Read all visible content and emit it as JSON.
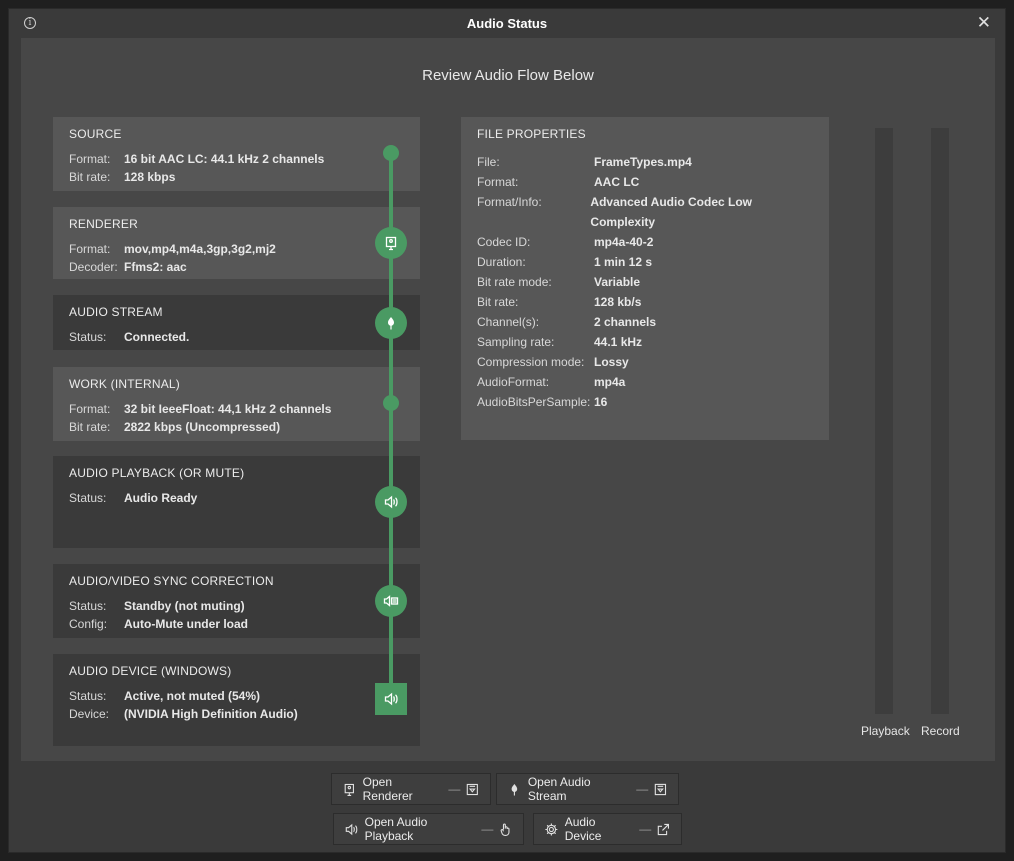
{
  "window": {
    "title": "Audio Status"
  },
  "heading": "Review Audio Flow Below",
  "source": {
    "title": "SOURCE",
    "rows": [
      {
        "label": "Format:",
        "value": "16 bit AAC LC: 44.1 kHz 2 channels"
      },
      {
        "label": "Bit rate:",
        "value": "128 kbps"
      }
    ]
  },
  "renderer": {
    "title": "RENDERER",
    "rows": [
      {
        "label": "Format:",
        "value": "mov,mp4,m4a,3gp,3g2,mj2"
      },
      {
        "label": "Decoder:",
        "value": "Ffms2: aac"
      }
    ]
  },
  "audio_stream": {
    "title": "AUDIO STREAM",
    "rows": [
      {
        "label": "Status:",
        "value": "Connected."
      }
    ]
  },
  "work": {
    "title": "WORK (INTERNAL)",
    "rows": [
      {
        "label": "Format:",
        "value": "32 bit IeeeFloat: 44,1 kHz 2 channels"
      },
      {
        "label": "Bit rate:",
        "value": "2822 kbps (Uncompressed)"
      }
    ]
  },
  "playback": {
    "title": "AUDIO PLAYBACK (OR MUTE)",
    "rows": [
      {
        "label": "Status:",
        "value": "Audio Ready"
      }
    ]
  },
  "sync": {
    "title": "AUDIO/VIDEO SYNC CORRECTION",
    "rows": [
      {
        "label": "Status:",
        "value": "Standby (not muting)"
      },
      {
        "label": "Config:",
        "value": "Auto-Mute under load"
      }
    ]
  },
  "device": {
    "title": "AUDIO DEVICE (WINDOWS)",
    "rows": [
      {
        "label": "Status:",
        "value": "Active, not muted (54%)"
      },
      {
        "label": "Device:",
        "value": "(NVIDIA High Definition Audio)"
      }
    ]
  },
  "file_properties": {
    "title": "FILE PROPERTIES",
    "rows": [
      {
        "label": "File:",
        "value": "FrameTypes.mp4"
      },
      {
        "label": "Format:",
        "value": "AAC LC"
      },
      {
        "label": "Format/Info:",
        "value": "Advanced Audio Codec Low Complexity"
      },
      {
        "label": "Codec ID:",
        "value": "mp4a-40-2"
      },
      {
        "label": "Duration:",
        "value": "1 min 12 s"
      },
      {
        "label": "Bit rate mode:",
        "value": "Variable"
      },
      {
        "label": "Bit rate:",
        "value": "128 kb/s"
      },
      {
        "label": "Channel(s):",
        "value": "2 channels"
      },
      {
        "label": "Sampling rate:",
        "value": "44.1 kHz"
      },
      {
        "label": "Compression mode:",
        "value": "Lossy"
      },
      {
        "label": "AudioFormat:",
        "value": "mp4a"
      },
      {
        "label": "AudioBitsPerSample:",
        "value": "16"
      }
    ]
  },
  "meters": {
    "playback_label": "Playback",
    "record_label": "Record"
  },
  "buttons": {
    "open_renderer": "Open Renderer",
    "open_audio_stream": "Open Audio Stream",
    "open_audio_playback": "Open Audio Playback",
    "audio_device": "Audio Device"
  },
  "colors": {
    "accent": "#4a9a63",
    "panel_light": "#575757",
    "panel_dark": "#3a3a3a",
    "background": "#474747"
  },
  "icons": [
    "info-icon",
    "close-icon",
    "renderer-icon",
    "stream-icon",
    "speaker-icon",
    "sync-icon",
    "dropdown-icon",
    "hand-icon",
    "gear-icon",
    "external-link-icon"
  ]
}
